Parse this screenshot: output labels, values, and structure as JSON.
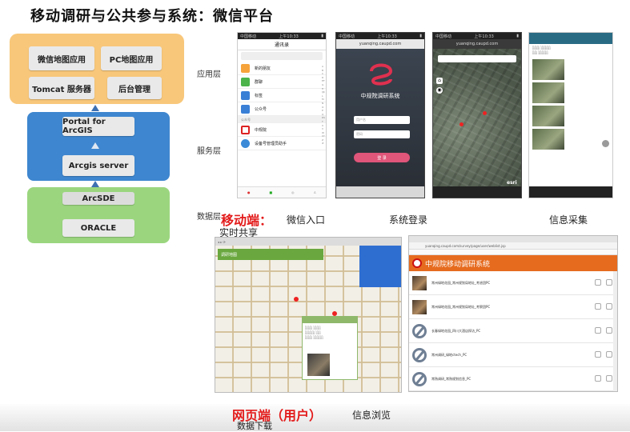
{
  "title": "移动调研与公共参与系统：微信平台",
  "arch": {
    "app_boxes": [
      "微信地图应用",
      "PC地图应用",
      "Tomcat 服务器",
      "后台管理"
    ],
    "svc_boxes": [
      "Portal for ArcGIS",
      "Arcgis server"
    ],
    "data_boxes": [
      "ArcSDE",
      "ORACLE"
    ],
    "layer_labels": [
      "应用层",
      "服务层",
      "数据层"
    ]
  },
  "colors": {
    "app_layer": "#f8c77a",
    "service_layer": "#3e86cf",
    "data_layer": "#9bd67f",
    "mobile_label": "#e31b1b",
    "web_header": "#e66b1f"
  },
  "wechat": {
    "header": "通讯录",
    "rows": [
      "新的朋友",
      "群聊",
      "标签",
      "公众号",
      "中规院",
      "设备号管理员助手"
    ],
    "section": "公众号",
    "tabs": [
      "",
      "",
      "",
      ""
    ]
  },
  "login": {
    "url": "yuanqing.caupd.com",
    "system_name": "中规院调研系统",
    "user_placeholder": "用户名",
    "pass_placeholder": "密码",
    "button": "登 录"
  },
  "map_phone": {
    "url": "yuanqing.caupd.com",
    "brand": "esri"
  },
  "captions": {
    "mobile": "移动端：",
    "wechat_entry": "微信入口",
    "login": "系统登录",
    "collect": "信息采集",
    "share": "实时共享",
    "web": "网页端（用户）",
    "browse": "信息浏览",
    "download": "数据下载"
  },
  "weblist": {
    "url": "yuanqing.caupd.com/survey/page/user/weblist.jsp",
    "header": "中规院移动调研系统",
    "items": [
      "常州绿地花园_常州规划局地址_考虑团PC",
      "常州绿地花园_常州规划局地址_考察团PC",
      "长春绿地花园_四川大酒店探访_PC",
      "常州调研_绿地ctech_PC",
      "常熟调研_常熟规划信息_PC"
    ]
  },
  "webmap": {
    "panel_title": "调研地图"
  }
}
